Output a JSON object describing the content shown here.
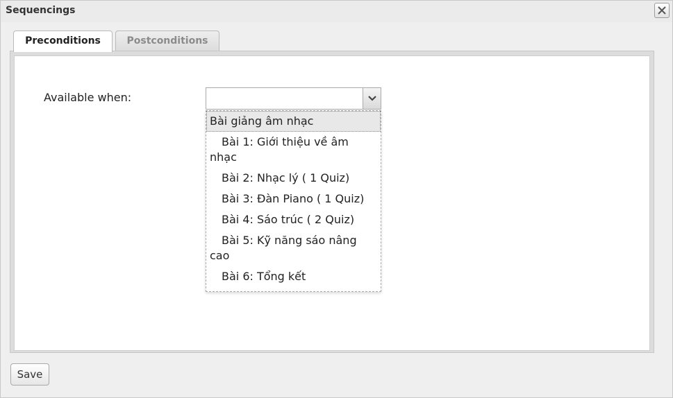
{
  "dialog": {
    "title": "Sequencings"
  },
  "tabs": [
    {
      "label": "Preconditions",
      "active": true
    },
    {
      "label": "Postconditions",
      "active": false
    }
  ],
  "form": {
    "available_when_label": "Available when:",
    "select_value": ""
  },
  "dropdown": {
    "options": [
      {
        "label": "Bài giảng âm nhạc",
        "kind": "group",
        "highlighted": true
      },
      {
        "label": "Bài 1: Giới thiệu về âm nhạc",
        "kind": "child"
      },
      {
        "label": "Bài 2: Nhạc lý ( 1 Quiz)",
        "kind": "child"
      },
      {
        "label": "Bài 3: Đàn Piano ( 1 Quiz)",
        "kind": "child"
      },
      {
        "label": "Bài 4: Sáo trúc ( 2 Quiz)",
        "kind": "child"
      },
      {
        "label": "Bài 5: Kỹ năng sáo nâng cao",
        "kind": "child"
      },
      {
        "label": "Bài 6: Tổng kết",
        "kind": "child"
      }
    ]
  },
  "footer": {
    "save_label": "Save"
  },
  "icons": {
    "close": "close-icon",
    "dropdown": "chevron-down-icon"
  }
}
